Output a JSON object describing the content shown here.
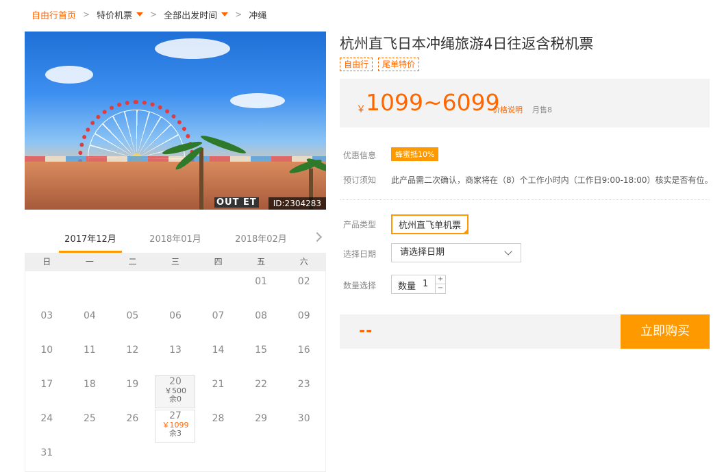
{
  "breadcrumb": {
    "home": "自由行首页",
    "items": [
      "特价机票",
      "全部出发时间",
      "冲绳"
    ]
  },
  "hero": {
    "image_id": "ID:2304283",
    "sign_text": "OUT ET"
  },
  "calendar": {
    "months": [
      "2017年12月",
      "2018年01月",
      "2018年02月"
    ],
    "weekdays": [
      "日",
      "一",
      "二",
      "三",
      "四",
      "五",
      "六"
    ],
    "days": [
      {
        "d": ""
      },
      {
        "d": ""
      },
      {
        "d": ""
      },
      {
        "d": ""
      },
      {
        "d": ""
      },
      {
        "d": "01"
      },
      {
        "d": "02"
      },
      {
        "d": "03"
      },
      {
        "d": "04"
      },
      {
        "d": "05"
      },
      {
        "d": "06"
      },
      {
        "d": "07"
      },
      {
        "d": "08"
      },
      {
        "d": "09"
      },
      {
        "d": "10"
      },
      {
        "d": "11"
      },
      {
        "d": "12"
      },
      {
        "d": "13"
      },
      {
        "d": "14"
      },
      {
        "d": "15"
      },
      {
        "d": "16"
      },
      {
        "d": "17"
      },
      {
        "d": "18"
      },
      {
        "d": "19"
      },
      {
        "d": "20",
        "price": "￥500",
        "stock": "余0",
        "sel": true
      },
      {
        "d": "21"
      },
      {
        "d": "22"
      },
      {
        "d": "23"
      },
      {
        "d": "24"
      },
      {
        "d": "25"
      },
      {
        "d": "26"
      },
      {
        "d": "27",
        "price": "￥1099",
        "stock": "余3",
        "orange": true
      },
      {
        "d": "28"
      },
      {
        "d": "29"
      },
      {
        "d": "30"
      },
      {
        "d": "31"
      }
    ]
  },
  "product": {
    "title": "杭州直飞日本冲绳旅游4日往返含税机票",
    "tags": [
      "自由行",
      "尾单特价"
    ],
    "currency": "￥",
    "price_range": "1099~6099",
    "price_note": "价格说明",
    "sold": "月售8"
  },
  "info": {
    "promo_label": "优惠信息",
    "promo_value": "蜂蜜抵10%",
    "booking_label": "预订须知",
    "booking_value": "此产品需二次确认，商家将在（8）个工作小时内（工作日9:00-18:00）核实是否有位。",
    "type_label": "产品类型",
    "type_value": "杭州直飞单机票",
    "date_label": "选择日期",
    "date_placeholder": "请选择日期",
    "qty_label": "数量选择",
    "qty_inner_label": "数量",
    "qty_value": "1",
    "plus": "+",
    "minus": "−"
  },
  "buy": {
    "total": "--",
    "button": "立即购买"
  },
  "colors": {
    "accent": "#ff6600",
    "button": "#ff9900"
  }
}
